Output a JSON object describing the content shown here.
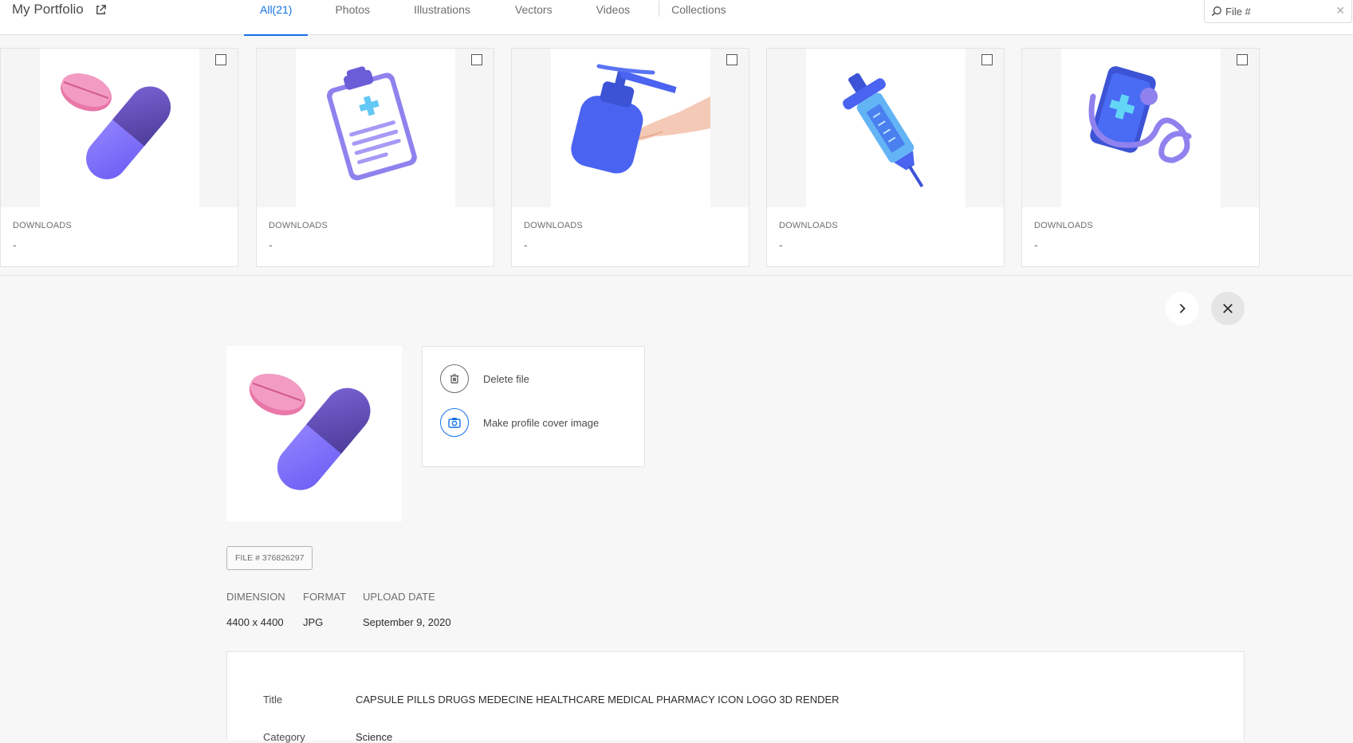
{
  "header": {
    "title": "My Portfolio",
    "tabs": [
      {
        "label": "All(21)",
        "active": true
      },
      {
        "label": "Photos"
      },
      {
        "label": "Illustrations"
      },
      {
        "label": "Vectors"
      },
      {
        "label": "Videos"
      },
      {
        "label": "Collections"
      }
    ],
    "search_placeholder": "File #"
  },
  "cards": [
    {
      "icon": "capsule-pills-image",
      "downloads_label": "DOWNLOADS",
      "downloads_value": "-"
    },
    {
      "icon": "clipboard-image",
      "downloads_label": "DOWNLOADS",
      "downloads_value": "-"
    },
    {
      "icon": "hand-sanitizer-image",
      "downloads_label": "DOWNLOADS",
      "downloads_value": "-"
    },
    {
      "icon": "syringe-image",
      "downloads_label": "DOWNLOADS",
      "downloads_value": "-"
    },
    {
      "icon": "phone-stethoscope-image",
      "downloads_label": "DOWNLOADS",
      "downloads_value": "-"
    }
  ],
  "detail": {
    "actions": {
      "delete": "Delete file",
      "cover": "Make profile cover image"
    },
    "file_id": "FILE # 376826297",
    "meta": {
      "dimension_label": "DIMENSION",
      "dimension_value": "4400 x 4400",
      "format_label": "FORMAT",
      "format_value": "JPG",
      "upload_label": "UPLOAD DATE",
      "upload_value": "September 9, 2020"
    },
    "info": {
      "title_label": "Title",
      "title_value": "CAPSULE PILLS DRUGS MEDECINE HEALTHCARE MEDICAL PHARMACY ICON LOGO 3D RENDER",
      "category_label": "Category",
      "category_value": "Science"
    }
  },
  "colors": {
    "accent": "#1473e6",
    "purple": "#8a7cf2",
    "pink": "#ef8fb8",
    "blue": "#4a63f0"
  }
}
